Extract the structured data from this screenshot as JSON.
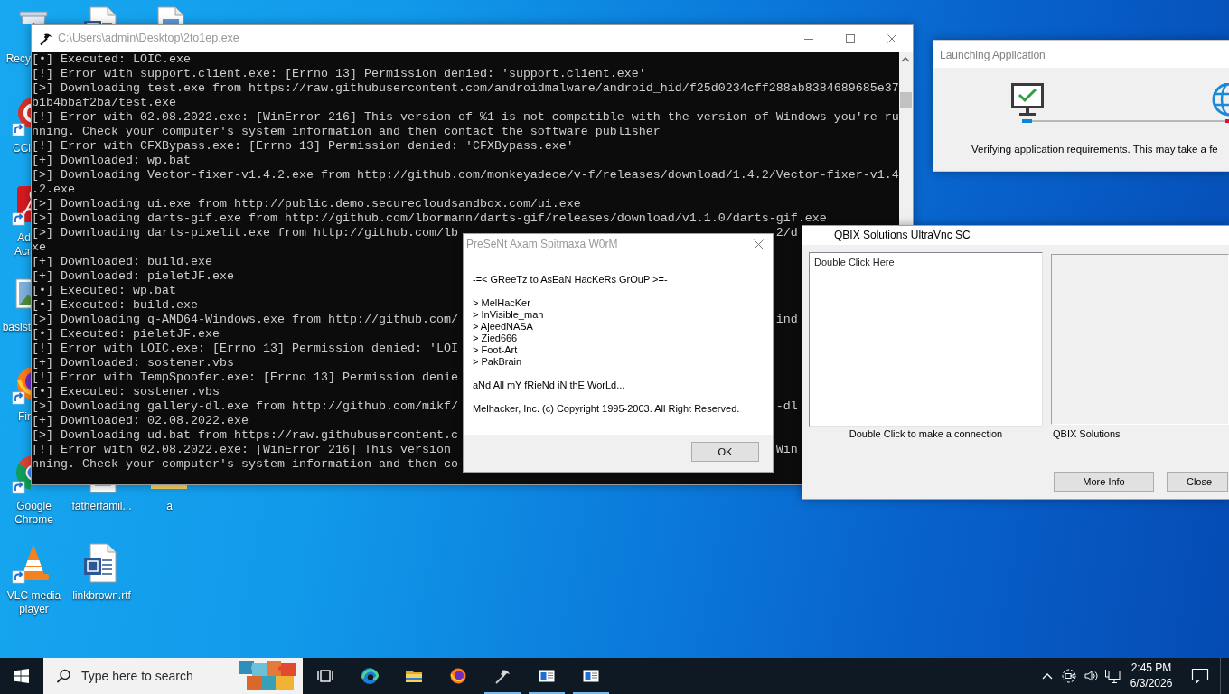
{
  "desktop_icons": [
    {
      "kind": "recyclebin",
      "label": "Recy",
      "shortcut": false
    },
    {
      "kind": "word"
    },
    {
      "kind": "document"
    },
    {
      "kind": "ccleaner",
      "label": "CCl",
      "shortcut": true
    },
    {
      "kind": "acrobat",
      "label": "Ad\nAcr",
      "shortcut": true
    },
    {
      "kind": "picture",
      "label": "basist",
      "shortcut": false
    },
    {
      "kind": "firefox",
      "label": "Fir",
      "shortcut": true
    },
    {
      "kind": "chrome",
      "label": "Google Chrome",
      "shortcut": true
    },
    {
      "kind": "document",
      "label": "fatherfamil...",
      "shortcut": false
    },
    {
      "kind": "folder",
      "label": "a",
      "shortcut": false
    },
    {
      "kind": "vlc",
      "label": "VLC media player",
      "shortcut": true
    },
    {
      "kind": "word",
      "label": "linkbrown.rtf",
      "shortcut": false
    }
  ],
  "console": {
    "title": "C:\\Users\\admin\\Desktop\\2to1ep.exe",
    "active": false,
    "lines": [
      {
        "text": "[•] Executed: LOIC.exe"
      },
      {
        "text": "[!] Error with support.client.exe: [Errno 13] Permission denied: 'support.client.exe'"
      },
      {
        "text": "[>] Downloading test.exe from https://raw.githubusercontent.com/androidmalware/android_hid/f25d0234cff288ab8384689685e37"
      },
      {
        "text": "b1b4bbaf2ba/test.exe"
      },
      {
        "text": "[!] Error with 02.08.2022.exe: [WinError 216] This version of %1 is not compatible with the version of Windows you're ru"
      },
      {
        "text": "nning. Check your computer's system information and then contact the software publisher"
      },
      {
        "text": "[!] Error with CFXBypass.exe: [Errno 13] Permission denied: 'CFXBypass.exe'"
      },
      {
        "text": "[+] Downloaded: wp.bat"
      },
      {
        "text": "[>] Downloading Vector-fixer-v1.4.2.exe from http://github.com/monkeyadece/v-f/releases/download/1.4.2/Vector-fixer-v1.4"
      },
      {
        "text": ".2.exe"
      },
      {
        "text": "[>] Downloading ui.exe from http://public.demo.securecloudsandbox.com/ui.exe"
      },
      {
        "text": "[>] Downloading darts-gif.exe from http://github.com/lbormann/darts-gif/releases/download/v1.1.0/darts-gif.exe"
      },
      {
        "text": "[>] Downloading darts-pixelit.exe from http://github.com/lb",
        "tail": "2/d"
      },
      {
        "text": "xe"
      },
      {
        "text": "[+] Downloaded: build.exe"
      },
      {
        "text": "[+] Downloaded: pieletJF.exe"
      },
      {
        "text": "[•] Executed: wp.bat"
      },
      {
        "text": "[•] Executed: build.exe"
      },
      {
        "text": "[>] Downloading q-AMD64-Windows.exe from http://github.com/",
        "tail": "ind"
      },
      {
        "text": "[•] Executed: pieletJF.exe"
      },
      {
        "text": "[!] Error with LOIC.exe: [Errno 13] Permission denied: 'LOI"
      },
      {
        "text": "[+] Downloaded: sostener.vbs"
      },
      {
        "text": "[!] Error with TempSpoofer.exe: [Errno 13] Permission denie"
      },
      {
        "text": "[•] Executed: sostener.vbs"
      },
      {
        "text": "[>] Downloading gallery-dl.exe from http://github.com/mikf/",
        "tail": "-dl"
      },
      {
        "text": "[+] Downloaded: 02.08.2022.exe"
      },
      {
        "text": "[>] Downloading ud.bat from https://raw.githubusercontent.c"
      },
      {
        "text": "[!] Error with 02.08.2022.exe: [WinError 216] This version",
        "tail": "Win"
      },
      {
        "text": "nning. Check your computer's system information and then co"
      }
    ]
  },
  "launcher": {
    "title": "Launching Application",
    "active": false,
    "status": "Verifying application requirements. This may take a fe"
  },
  "dialog": {
    "title": "PreSeNt Axam Spitmaxa W0rM",
    "active": false,
    "paragraphs": [
      [
        "-=< GReeTz to AsEaN HacKeRs GrOuP >=-"
      ],
      [
        "> MelHacKer",
        "> InVisible_man",
        "> AjeedNASA",
        "> Zied666",
        "> Foot-Art",
        "> PakBrain"
      ],
      [
        "aNd All mY fRieNd iN thE WorLd..."
      ],
      [
        "Melhacker, Inc. (c) Copyright 1995-2003. All Right Reserved."
      ]
    ],
    "button": "OK"
  },
  "vnc_window": {
    "title": "QBIX Solutions UltraVnc SC",
    "active": true,
    "list_items": [
      "Double Click Here"
    ],
    "list_caption": "Double Click to make a connection",
    "panel_caption": "QBIX Solutions",
    "buttons": [
      "More Info",
      "Close"
    ]
  },
  "taskbar": {
    "search": {
      "placeholder": "Type here to search"
    },
    "apps": [
      {
        "kind": "taskview",
        "running": false
      },
      {
        "kind": "edge",
        "running": false
      },
      {
        "kind": "explorer",
        "running": false
      },
      {
        "kind": "firefox",
        "running": false
      },
      {
        "kind": "hammer",
        "running": true
      },
      {
        "kind": "window",
        "running": true
      },
      {
        "kind": "window",
        "running": true
      }
    ],
    "clock": {
      "time": "2:45 PM",
      "date": "6/3/2026"
    }
  }
}
